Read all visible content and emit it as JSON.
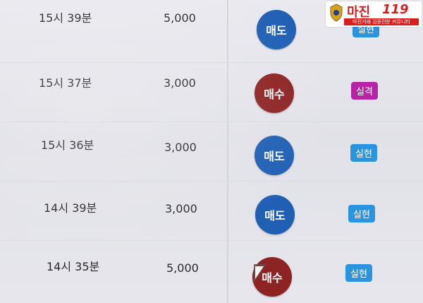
{
  "colors": {
    "sell": "#1f5fb4",
    "buy": "#8e2323",
    "realized_badge": "#2a94de",
    "loss_badge": "#b623a5"
  },
  "trades": [
    {
      "time": "15시 39분",
      "qty": "5,000",
      "action": "매도",
      "type": "sell",
      "status": "실현"
    },
    {
      "time": "15시 37분",
      "qty": "3,000",
      "action": "매수",
      "type": "buy",
      "status": "실격"
    },
    {
      "time": "15시 36분",
      "qty": "3,000",
      "action": "매도",
      "type": "sell",
      "status": "실현"
    },
    {
      "time": "14시 39분",
      "qty": "3,000",
      "action": "매도",
      "type": "sell",
      "status": "실현"
    },
    {
      "time": "14시 35분",
      "qty": "5,000",
      "action": "매수",
      "type": "buy",
      "status": "실현"
    }
  ],
  "watermark": {
    "brand": "마진",
    "number": "119",
    "tagline": "마진거래 검증전문 커뮤니티"
  }
}
